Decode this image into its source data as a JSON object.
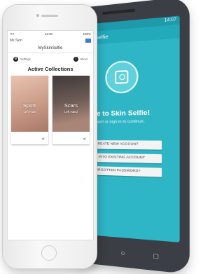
{
  "android": {
    "status_time": "14:07",
    "app_title": "Into Skin Selfie",
    "welcome": "Welcome to Skin Selfie!",
    "subtitle": "Create an account or sign in to continue.",
    "buttons": [
      {
        "label": "CREATE NEW ACCOUNT"
      },
      {
        "label": "SIGN INTO EXISTING ACCOUNT"
      },
      {
        "label": "FORGOTTEN PASSWORD?"
      }
    ],
    "nav": [
      "◁",
      "○",
      "□"
    ]
  },
  "ios": {
    "status_carrier": "•••• ",
    "status_time": "14:30",
    "status_battery": "100%",
    "top_left": "Ms Skin",
    "title": "MySkinSelfie",
    "settings_label": "Settings",
    "about_label": "About",
    "section_title": "Active Collections",
    "cards": [
      {
        "name": "Spots",
        "subtitle": "Left Face"
      },
      {
        "name": "Scars",
        "subtitle": "Left Hand"
      }
    ]
  },
  "colors": {
    "android_teal": "#2fb6c6",
    "android_body": "#3b3e44",
    "ios_body": "#efefef"
  }
}
